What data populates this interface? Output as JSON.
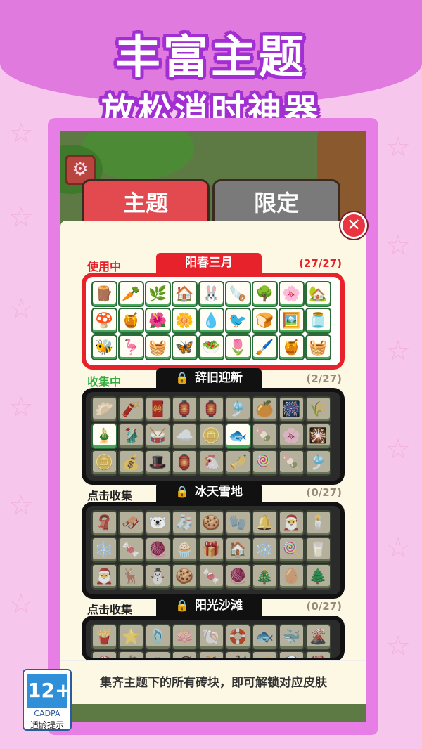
{
  "banner": {
    "line1": "丰富主题",
    "line2": "放松消时神器"
  },
  "tabs": [
    {
      "label": "主题"
    },
    {
      "label": "限定"
    }
  ],
  "icons": {
    "settings": "gear-icon",
    "close": "close-icon",
    "lock": "lock-icon",
    "star": "star-icon"
  },
  "sections": [
    {
      "status": "使用中",
      "status_color": "#e8222b",
      "title": "阳春三月",
      "locked": false,
      "count": "(27/27)",
      "frame_color": "#e8222b",
      "tiles": [
        "🪵",
        "🥕",
        "🌿",
        "🏠",
        "🐰",
        "🪚",
        "🌳",
        "🌸",
        "🏡",
        "🍄",
        "🍯",
        "🌺",
        "🌼",
        "💧",
        "🐦",
        "🍞",
        "🖼️",
        "🫙",
        "🐝",
        "🦩",
        "🧺",
        "🦋",
        "🥗",
        "🌷",
        "🖌️",
        "🍯",
        "🧺"
      ],
      "dim": []
    },
    {
      "status": "收集中",
      "status_color": "#2fae3f",
      "title": "辞旧迎新",
      "locked": true,
      "count": "(2/27)",
      "frame_color": "#111111",
      "tiles": [
        "🥟",
        "🧨",
        "🧧",
        "🏮",
        "🏮",
        "🎐",
        "🍊",
        "🎆",
        "🌾",
        "🎍",
        "🥻",
        "🥁",
        "☁️",
        "🪙",
        "🐟",
        "🍡",
        "🌸",
        "🎇",
        "🪙",
        "💰",
        "🎩",
        "🏮",
        "🐔",
        "🎺",
        "🍭",
        "🍡",
        "🎐"
      ],
      "dim": [
        true,
        true,
        true,
        true,
        true,
        true,
        true,
        true,
        true,
        false,
        true,
        true,
        true,
        true,
        false,
        true,
        true,
        true,
        true,
        true,
        true,
        true,
        true,
        true,
        true,
        true,
        true
      ]
    },
    {
      "status": "点击收集",
      "status_color": "#222222",
      "title": "冰天雪地",
      "locked": true,
      "count": "(0/27)",
      "frame_color": "#111111",
      "tiles": [
        "🧣",
        "🛷",
        "🐻‍❄️",
        "🧦",
        "🍪",
        "🧤",
        "🔔",
        "🎅",
        "🕯️",
        "❄️",
        "🍬",
        "🧶",
        "🧁",
        "🎁",
        "🏠",
        "❄️",
        "🍭",
        "🥛",
        "🎅",
        "🦌",
        "⛄",
        "🍪",
        "🍬",
        "🧶",
        "🎄",
        "🥚",
        "🌲"
      ],
      "dim": [
        true,
        true,
        true,
        true,
        true,
        true,
        true,
        true,
        true,
        true,
        true,
        true,
        true,
        true,
        true,
        true,
        true,
        true,
        true,
        true,
        true,
        true,
        true,
        true,
        true,
        true,
        true
      ]
    },
    {
      "status": "点击收集",
      "status_color": "#222222",
      "title": "阳光沙滩",
      "locked": true,
      "count": "(0/27)",
      "frame_color": "#111111",
      "tiles": [
        "🍟",
        "⭐",
        "🩴",
        "🪷",
        "🐚",
        "🛟",
        "🐟",
        "🐳",
        "🌋",
        "🏖️",
        "🌴",
        "🦀",
        "🥥",
        "🍹",
        "🏄",
        "🐠",
        "🌊",
        "🦞"
      ],
      "dim": [
        true,
        true,
        true,
        true,
        true,
        true,
        true,
        true,
        true,
        true,
        true,
        true,
        true,
        true,
        true,
        true,
        true,
        true
      ]
    }
  ],
  "bottom_hint": "集齐主题下的所有砖块，即可解锁对应皮肤",
  "age_rating": {
    "number": "12+",
    "org": "CADPA",
    "hint": "适龄提示"
  }
}
